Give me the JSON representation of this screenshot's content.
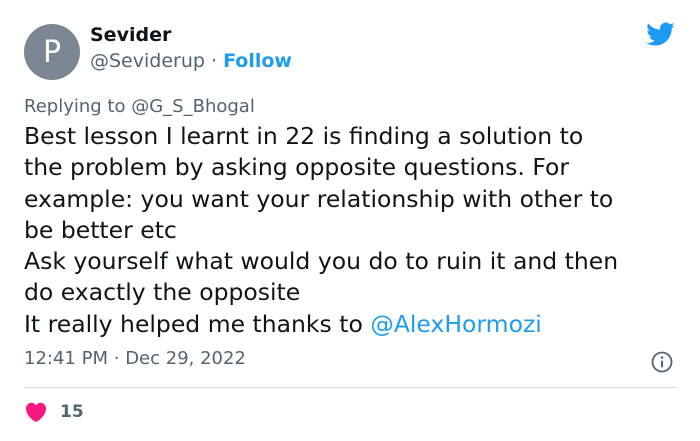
{
  "author": {
    "avatar_letter": "P",
    "name": "Sevider",
    "handle": "@Seviderup",
    "separator": "·",
    "follow_label": "Follow"
  },
  "icons": {
    "brand": "twitter-bird-icon",
    "info": "info-icon",
    "like": "heart-icon"
  },
  "colors": {
    "accent": "#1d9bf0",
    "like": "#f91880",
    "avatar_bg": "#7a8691",
    "secondary_text": "#536471"
  },
  "reply": {
    "prefix": "Replying to",
    "target": "@G_S_Bhogal"
  },
  "tweet": {
    "lines": [
      "Best lesson I learnt in 22 is finding a solution to",
      "the problem by asking opposite questions. For",
      "example: you want your relationship with other to",
      "be better etc",
      "Ask yourself what would you do to ruin it and then",
      "do exactly the opposite"
    ],
    "last_line_text": "It really helped me thanks to",
    "last_line_mention": "@AlexHormozi"
  },
  "meta": {
    "time": "12:41 PM",
    "separator": "·",
    "date": "Dec 29, 2022"
  },
  "likes": {
    "count": "15"
  }
}
